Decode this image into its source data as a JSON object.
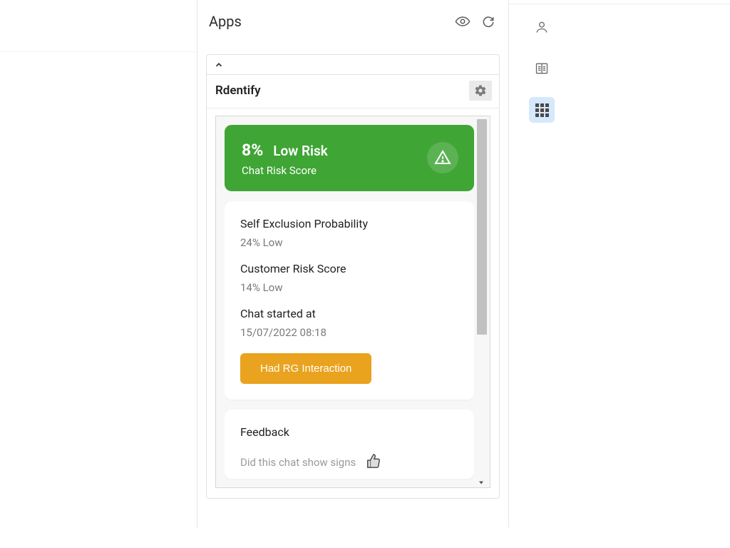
{
  "header": {
    "title": "Apps"
  },
  "app": {
    "name": "Rdentify"
  },
  "risk": {
    "percent": "8%",
    "level": "Low Risk",
    "subtitle": "Chat Risk Score"
  },
  "details": {
    "self_exclusion_label": "Self Exclusion Probability",
    "self_exclusion_value": "24% Low",
    "customer_risk_label": "Customer Risk Score",
    "customer_risk_value": "14% Low",
    "chat_started_label": "Chat started at",
    "chat_started_value": "15/07/2022 08:18",
    "rg_button": "Had RG Interaction"
  },
  "feedback": {
    "title": "Feedback",
    "question": "Did this chat show signs"
  }
}
